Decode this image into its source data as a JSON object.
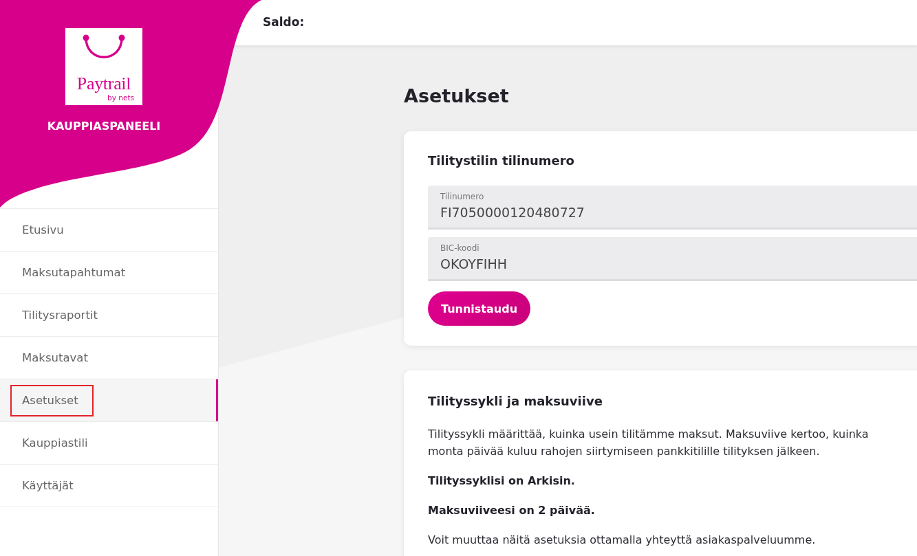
{
  "sidebar": {
    "logo": {
      "name": "Paytrail",
      "tagline": "by nets"
    },
    "title": "KAUPPIASPANEELI",
    "items": [
      {
        "label": "Etusivu",
        "selected": false,
        "outlined": false
      },
      {
        "label": "Maksutapahtumat",
        "selected": false,
        "outlined": false
      },
      {
        "label": "Tilitysraportit",
        "selected": false,
        "outlined": false
      },
      {
        "label": "Maksutavat",
        "selected": false,
        "outlined": false
      },
      {
        "label": "Asetukset",
        "selected": true,
        "outlined": true
      },
      {
        "label": "Kauppiastili",
        "selected": false,
        "outlined": false
      },
      {
        "label": "Käyttäjät",
        "selected": false,
        "outlined": false
      }
    ]
  },
  "top_bar": {
    "label": "Saldo:"
  },
  "page": {
    "title": "Asetukset",
    "account_card": {
      "title": "Tilitystilin tilinumero",
      "fields": [
        {
          "label": "Tilinumero",
          "value": "FI7050000120480727"
        },
        {
          "label": "BIC-koodi",
          "value": "OKOYFIHH"
        }
      ],
      "button": "Tunnistaudu"
    },
    "cycle_card": {
      "title": "Tilityssykli ja maksuviive",
      "paragraphs": [
        {
          "kind": "text",
          "text": "Tilityssykli määrittää, kuinka usein tilitämme maksut. Maksuviive kertoo, kuinka monta päivää kuluu rahojen siirtymiseen pankkitilille tilityksen jälkeen."
        },
        {
          "kind": "emphasis",
          "text": "Tilityssyklisi on Arkisin."
        },
        {
          "kind": "emphasis",
          "text": "Maksuviiveesi on 2 päivää."
        },
        {
          "kind": "text",
          "text": "Voit muuttaa näitä asetuksia ottamalla yhteyttä asiakaspalveluumme."
        }
      ]
    }
  }
}
